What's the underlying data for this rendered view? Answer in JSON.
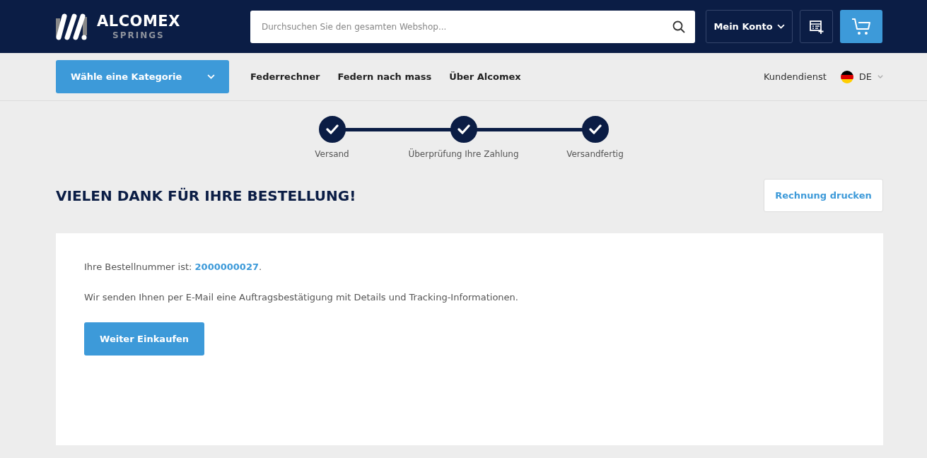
{
  "header": {
    "logo": {
      "name": "ALCOMEX",
      "sub": "SPRINGS"
    },
    "search": {
      "placeholder": "Durchsuchen Sie den gesamten Webshop..."
    },
    "account": "Mein Konto"
  },
  "nav": {
    "category": "Wähle eine Kategorie",
    "links": [
      "Federrechner",
      "Federn nach mass",
      "Über Alcomex"
    ],
    "service": "Kundendienst",
    "language": "DE"
  },
  "steps": [
    {
      "label": "Versand",
      "done": true
    },
    {
      "label": "Überprüfung Ihre Zahlung",
      "done": true
    },
    {
      "label": "Versandfertig",
      "done": true
    }
  ],
  "title": "VIELEN DANK FÜR IHRE BESTELLUNG!",
  "print_button": "Rechnung drucken",
  "card": {
    "order_prefix": "Ihre Bestellnummer ist: ",
    "order_number": "2000000027",
    "order_suffix": ".",
    "message": "Wir senden Ihnen per E-Mail eine Auftragsbestätigung mit Details und Tracking-Informationen.",
    "button": "Weiter Einkaufen"
  }
}
